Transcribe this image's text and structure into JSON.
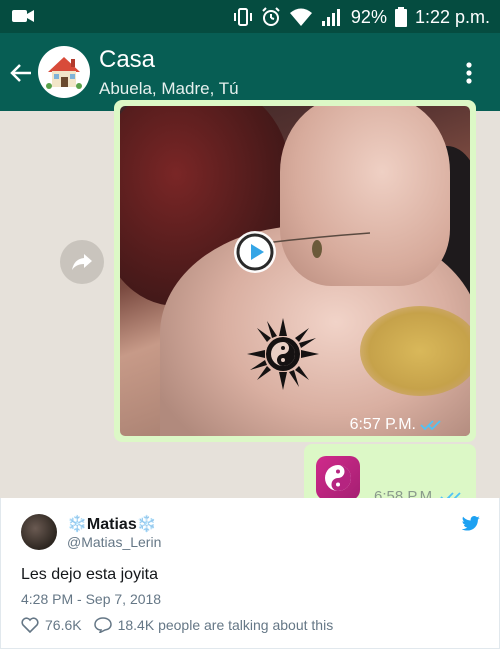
{
  "status_bar": {
    "battery": "92%",
    "time": "1:22 p.m."
  },
  "chat": {
    "title": "Casa",
    "participants": "Abuela, Madre, Tú"
  },
  "messages": [
    {
      "type": "video",
      "time": "6:57 P.M."
    },
    {
      "type": "sticker",
      "time": "6:58 P.M."
    }
  ],
  "tweet": {
    "name": "❄️Matias❄️",
    "handle": "@Matias_Lerin",
    "text": "Les dejo esta joyita",
    "date": "4:28 PM - Sep 7, 2018",
    "likes": "76.6K",
    "talking": "18.4K people are talking about this"
  },
  "colors": {
    "status_bar": "#054c40",
    "app_bar": "#075e54",
    "bubble": "#dcf8c6",
    "twitter_blue": "#1da1f2"
  }
}
